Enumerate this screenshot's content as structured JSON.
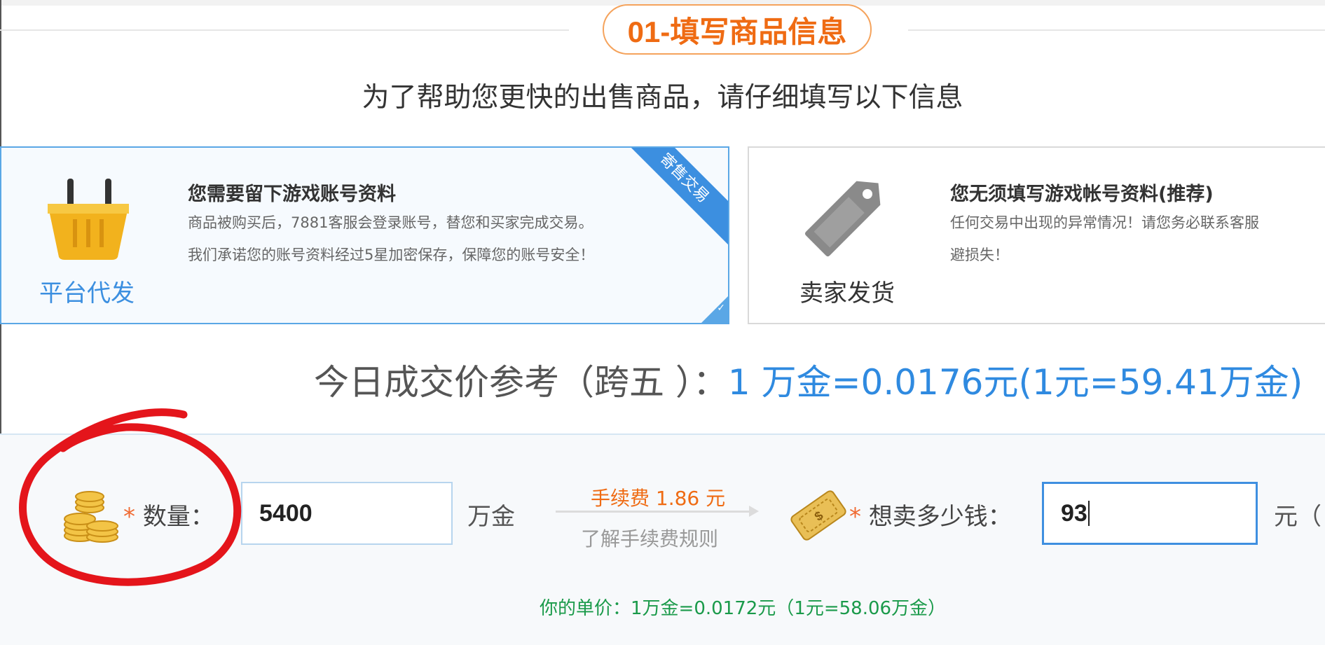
{
  "header": {
    "step_title": "01-填写商品信息",
    "subtitle": "为了帮助您更快的出售商品，请仔细填写以下信息"
  },
  "options": {
    "platform": {
      "label": "平台代发",
      "title": "您需要留下游戏账号资料",
      "desc_line1": "商品被购买后，7881客服会登录账号，替您和买家完成交易。",
      "desc_line2": "我们承诺您的账号资料经过5星加密保存，保障您的账号安全！",
      "ribbon": "寄售交易",
      "selected": true,
      "icon": "basket-icon"
    },
    "seller": {
      "label": "卖家发货",
      "title": "您无须填写游戏帐号资料(推荐)",
      "desc_line1": "任何交易中出现的异常情况！请您务必联系客服",
      "desc_line2": "避损失！",
      "selected": false,
      "icon": "price-tag-icon"
    }
  },
  "price_reference": {
    "label": "今日成交价参考（跨五 ）：",
    "value": "1 万金=0.0176元(1元=59.41万金)"
  },
  "form": {
    "quantity": {
      "label": "数量：",
      "required_mark": "*",
      "value": "5400",
      "unit": "万金",
      "icon": "gold-coins-icon"
    },
    "fee": {
      "text": "手续费 1.86  元",
      "rule_link": "了解手续费规则"
    },
    "price": {
      "label": "想卖多少钱：",
      "required_mark": "*",
      "value": "93",
      "unit": "元（",
      "icon": "ticket-icon"
    },
    "unit_price": "你的单价：1万金=0.0172元（1元=58.06万金）"
  },
  "colors": {
    "accent_orange": "#ef6b13",
    "accent_blue": "#2f8ae0",
    "success_green": "#1a9a4a",
    "annotation_red": "#e4151b"
  }
}
